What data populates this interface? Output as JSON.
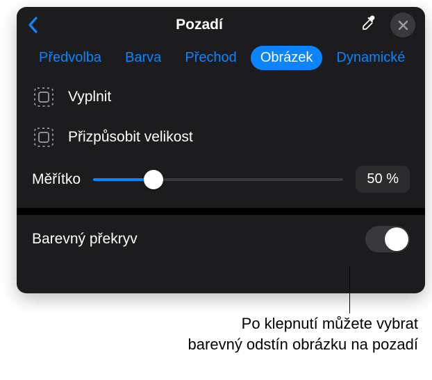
{
  "header": {
    "title": "Pozadí"
  },
  "tabs": {
    "items": [
      {
        "label": "Předvolba",
        "selected": false
      },
      {
        "label": "Barva",
        "selected": false
      },
      {
        "label": "Přechod",
        "selected": false
      },
      {
        "label": "Obrázek",
        "selected": true
      },
      {
        "label": "Dynamické",
        "selected": false
      }
    ]
  },
  "options": {
    "fill": "Vyplnit",
    "fit": "Přizpůsobit velikost"
  },
  "scale": {
    "label": "Měřítko",
    "value": "50 %",
    "percent": 24
  },
  "overlay": {
    "label": "Barevný překryv",
    "on": true
  },
  "callout": {
    "line1": "Po klepnutí můžete vybrat",
    "line2": "barevný odstín obrázku na pozadí"
  }
}
